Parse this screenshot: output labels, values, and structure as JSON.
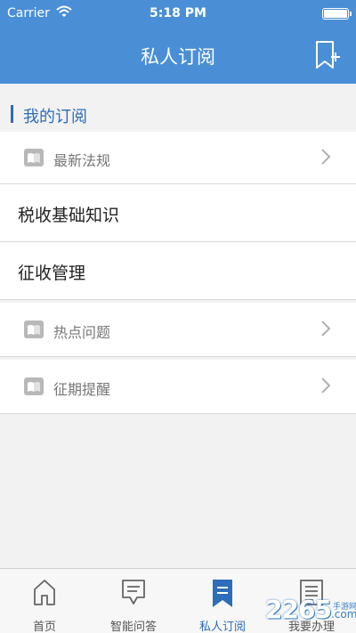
{
  "status": {
    "carrier": "Carrier",
    "time": "5:18 PM"
  },
  "nav": {
    "title": "私人订阅",
    "add_icon": "bookmark-add-icon"
  },
  "section": {
    "title": "我的订阅"
  },
  "rows": [
    {
      "label": "最新法规",
      "icon": "book-icon"
    },
    {
      "label": "税收基础知识"
    },
    {
      "label": "征收管理"
    },
    {
      "label": "热点问题",
      "icon": "book-icon"
    },
    {
      "label": "征期提醒",
      "icon": "book-icon"
    }
  ],
  "tabs": [
    {
      "label": "首页",
      "icon": "home-icon"
    },
    {
      "label": "智能问答",
      "icon": "chat-icon"
    },
    {
      "label": "私人订阅",
      "icon": "bookmark-icon",
      "active": true
    },
    {
      "label": "我要办理",
      "icon": "document-icon"
    }
  ],
  "watermark": {
    "text": "2265",
    "suffix": ".com",
    "subtitle": "手游网"
  },
  "colors": {
    "brand": "#4a8fd6",
    "accent": "#2e6db8",
    "background": "#f2f2f2"
  }
}
